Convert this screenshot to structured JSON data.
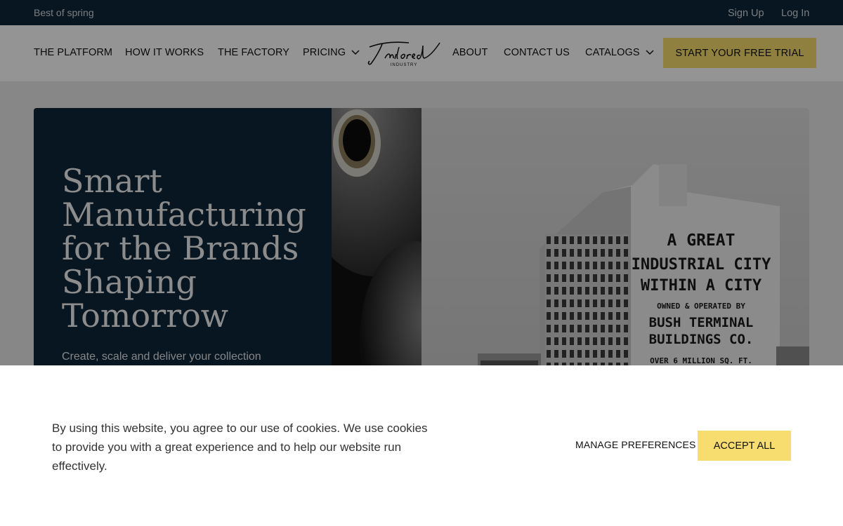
{
  "topbar": {
    "promo": "Best of spring",
    "sign_up": "Sign Up",
    "log_in": "Log In"
  },
  "nav": {
    "items": [
      {
        "label": "THE PLATFORM"
      },
      {
        "label": "HOW IT WORKS"
      },
      {
        "label": "THE FACTORY"
      },
      {
        "label": "PRICING",
        "has_dropdown": true
      },
      {
        "label": "ABOUT"
      },
      {
        "label": "CONTACT US"
      },
      {
        "label": "CATALOGS",
        "has_dropdown": true
      }
    ],
    "logo": {
      "name": "Tailored",
      "tagline": "INDUSTRY"
    },
    "cta": "START YOUR FREE TRIAL"
  },
  "hero": {
    "title": "Smart Manufacturing for the Brands Shaping Tomorrow",
    "subtitle": "Create, scale and deliver your collection",
    "building_sign": {
      "line1": "A GREAT",
      "line2": "INDUSTRIAL CITY",
      "line3": "WITHIN A CITY",
      "line4": "OWNED & OPERATED BY",
      "line5": "BUSH TERMINAL",
      "line6": "BUILDINGS CO.",
      "line7": "OVER 6 MILLION SQ. FT."
    }
  },
  "cookie_banner": {
    "text": "By using this website, you agree to our use of cookies. We use cookies to provide you with a great experience and to help our website run effectively.",
    "manage_label": "MANAGE PREFERENCES",
    "accept_label": "ACCEPT ALL"
  },
  "colors": {
    "navy": "#0d2639",
    "accent_yellow": "#f7dc6f",
    "overlay": "rgba(0,0,0,0.42)"
  },
  "icons": [
    "chevron-down-icon",
    "tailored-logo"
  ]
}
